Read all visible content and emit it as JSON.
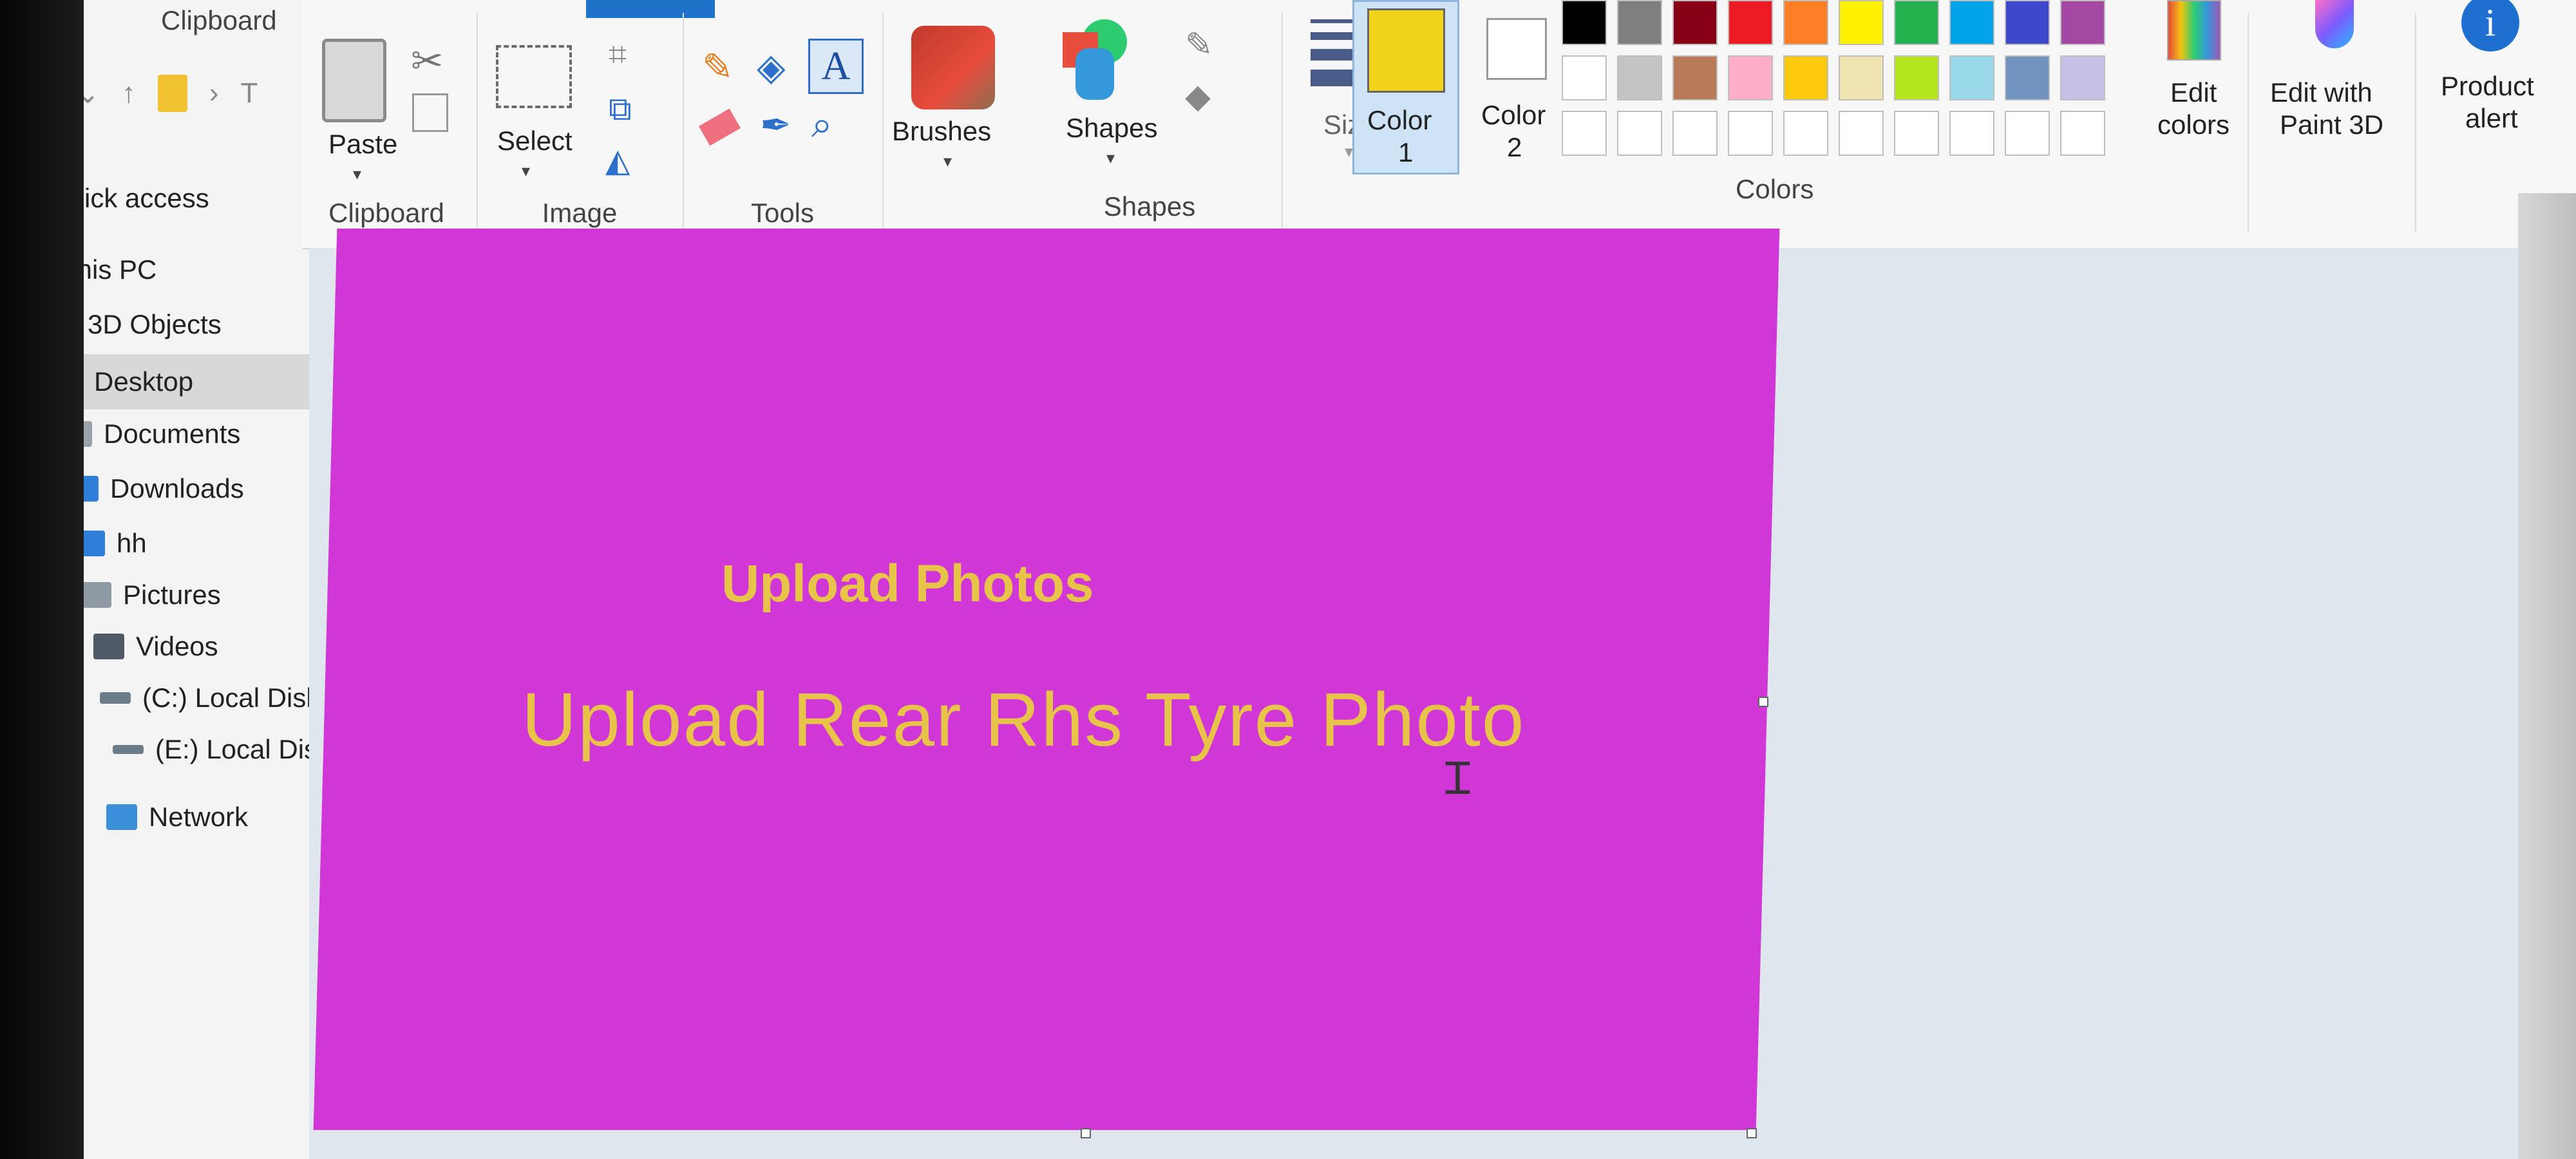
{
  "explorer": {
    "title": "Clipboard",
    "nav_path": "T",
    "quick_access": "Quick access",
    "this_pc": "This PC",
    "items": [
      {
        "label": "3D Objects",
        "icon": "cube-icon",
        "color": "#1b9bd1"
      },
      {
        "label": "Desktop",
        "icon": "desktop-icon",
        "color": "#1f6fd1"
      },
      {
        "label": "Documents",
        "icon": "document-icon",
        "color": "#9aa3ad"
      },
      {
        "label": "Downloads",
        "icon": "download-icon",
        "color": "#2f7fd9"
      },
      {
        "label": "hh",
        "icon": "music-note-icon",
        "color": "#2f7fd9"
      },
      {
        "label": "Pictures",
        "icon": "pictures-icon",
        "color": "#8f9aa5"
      },
      {
        "label": "Videos",
        "icon": "video-icon",
        "color": "#4f5a66"
      },
      {
        "label": "(C:) Local Disk",
        "icon": "drive-icon",
        "color": "#6c7b88"
      },
      {
        "label": "(E:) Local Disk",
        "icon": "drive-icon",
        "color": "#6c7b88"
      }
    ],
    "network": "Network"
  },
  "ribbon": {
    "paste": "Paste",
    "clipboard_group": "Clipboard",
    "select": "Select",
    "image_group": "Image",
    "tools_group": "Tools",
    "brushes": "Brushes",
    "shapes": "Shapes",
    "shapes_group": "Shapes",
    "size": "Size",
    "color1_top": "Color",
    "color1_bottom": "1",
    "color2_top": "Color",
    "color2_bottom": "2",
    "colors_group": "Colors",
    "edit_colors_top": "Edit",
    "edit_colors_bottom": "colors",
    "paint3d_top": "Edit with",
    "paint3d_bottom": "Paint 3D",
    "product_alert_top": "Product",
    "product_alert_bottom": "alert",
    "color1_value": "#f2d31b",
    "color2_value": "#ffffff",
    "palette_row1": [
      "#000000",
      "#7f7f7f",
      "#880015",
      "#ed1c24",
      "#ff7f27",
      "#fff200",
      "#22b14c",
      "#00a2e8",
      "#3f48cc",
      "#a349a4"
    ],
    "palette_row2": [
      "#ffffff",
      "#c3c3c3",
      "#b97a57",
      "#ffaec9",
      "#ffc90e",
      "#efe4b0",
      "#b5e61d",
      "#99d9ea",
      "#7092be",
      "#c8bfe7"
    ]
  },
  "canvas": {
    "background": "#d136d6",
    "title": "Upload Photos",
    "subtitle": "Upload Rear Rhs Tyre Photo"
  }
}
